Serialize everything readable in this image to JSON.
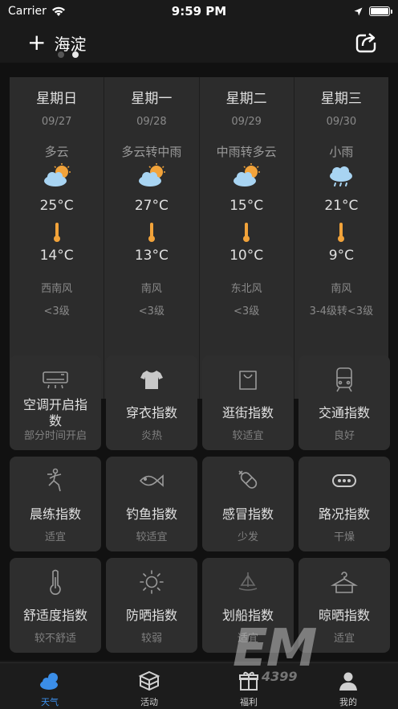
{
  "status": {
    "carrier": "Carrier",
    "time": "9:59 PM"
  },
  "nav": {
    "plus": "+",
    "city": "海淀"
  },
  "forecast": [
    {
      "day": "星期日",
      "date": "09/27",
      "condition": "多云",
      "icon": "partly-cloudy-icon",
      "high": "25°C",
      "low": "14°C",
      "wind": "西南风",
      "level": "<3级"
    },
    {
      "day": "星期一",
      "date": "09/28",
      "condition": "多云转中雨",
      "icon": "partly-cloudy-icon",
      "high": "27°C",
      "low": "13°C",
      "wind": "南风",
      "level": "<3级"
    },
    {
      "day": "星期二",
      "date": "09/29",
      "condition": "中雨转多云",
      "icon": "partly-cloudy-icon",
      "high": "15°C",
      "low": "10°C",
      "wind": "东北风",
      "level": "<3级"
    },
    {
      "day": "星期三",
      "date": "09/30",
      "condition": "小雨",
      "icon": "light-rain-icon",
      "high": "21°C",
      "low": "9°C",
      "wind": "南风",
      "level": "3-4级转<3级"
    }
  ],
  "indices": [
    {
      "icon": "air-conditioner-icon",
      "title": "空调开启指数",
      "value": "部分时间开启"
    },
    {
      "icon": "shirt-icon",
      "title": "穿衣指数",
      "value": "炎热"
    },
    {
      "icon": "shopping-bag-icon",
      "title": "逛街指数",
      "value": "较适宜"
    },
    {
      "icon": "train-icon",
      "title": "交通指数",
      "value": "良好"
    },
    {
      "icon": "exercise-icon",
      "title": "晨练指数",
      "value": "适宜"
    },
    {
      "icon": "fish-icon",
      "title": "钓鱼指数",
      "value": "较适宜"
    },
    {
      "icon": "pill-icon",
      "title": "感冒指数",
      "value": "少发"
    },
    {
      "icon": "road-condition-icon",
      "title": "路况指数",
      "value": "干燥"
    },
    {
      "icon": "thermometer-icon",
      "title": "舒适度指数",
      "value": "较不舒适"
    },
    {
      "icon": "sun-icon",
      "title": "防晒指数",
      "value": "较弱"
    },
    {
      "icon": "boat-icon",
      "title": "划船指数",
      "value": "适宜"
    },
    {
      "icon": "hanger-icon",
      "title": "晾晒指数",
      "value": "适宜"
    }
  ],
  "tabs": [
    {
      "icon": "weather-icon",
      "label": "天气",
      "active": true
    },
    {
      "icon": "activity-box-icon",
      "label": "活动",
      "active": false
    },
    {
      "icon": "gift-icon",
      "label": "福利",
      "active": false
    },
    {
      "icon": "user-icon",
      "label": "我的",
      "active": false
    }
  ],
  "watermark": {
    "main": "EM",
    "sub": "4399"
  },
  "colors": {
    "accent": "#3b8ee8",
    "sun": "#f2a33a",
    "cloud": "#a8d4f2"
  }
}
